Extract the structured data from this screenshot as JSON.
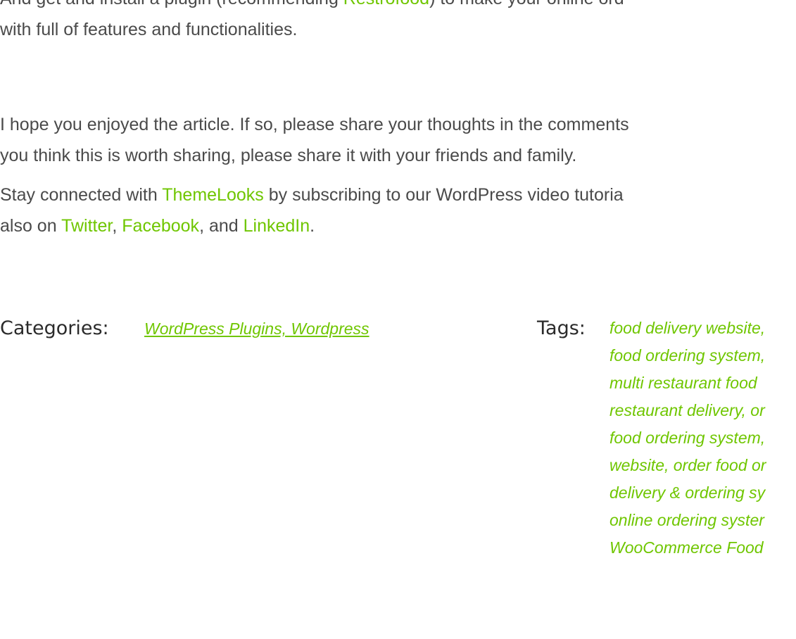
{
  "article": {
    "para1": {
      "line1_pre": "And get and install a plugin (recommending ",
      "line1_link": "Restrofood",
      "line1_post": ") to make your online ord",
      "line2": "with full of features and functionalities."
    },
    "para2": {
      "line1": "I hope you enjoyed the article. If so, please share your thoughts in the comments",
      "line2": "you think this is worth sharing, please share it with your friends and family."
    },
    "para3": {
      "line1_pre": "Stay connected with ",
      "line1_link": "ThemeLooks",
      "line1_post": " by subscribing to our WordPress video tutoria",
      "line2_pre": "also on ",
      "twitter": "Twitter",
      "sep1": ", ",
      "facebook": "Facebook",
      "sep2": ", and ",
      "linkedin": "LinkedIn",
      "line2_post": "."
    }
  },
  "meta": {
    "categories_label": "Categories:",
    "categories_value": "WordPress Plugins, Wordpress",
    "tags_label": "Tags:",
    "tags_lines": [
      "food delivery website,",
      "food ordering system,",
      "multi restaurant food",
      "restaurant delivery, or",
      "food ordering system,",
      "website, order food or",
      "delivery & ordering sy",
      "online ordering syster",
      "WooCommerce Food"
    ]
  },
  "colors": {
    "link": "#6fc600",
    "text": "#4a4a4a",
    "heading": "#2b2b2b"
  }
}
